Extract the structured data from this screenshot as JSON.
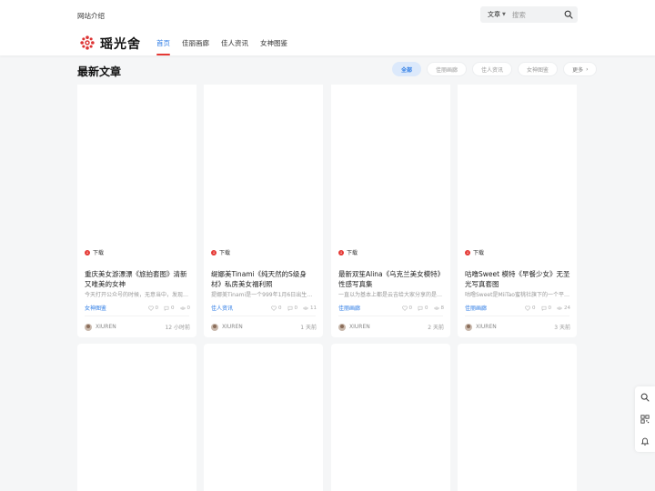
{
  "header": {
    "top_link": "网站介绍",
    "search_type": "文章",
    "search_placeholder": "搜索",
    "brand": "瑶光舍",
    "nav": [
      {
        "label": "首页",
        "active": true
      },
      {
        "label": "佳丽画廊",
        "active": false
      },
      {
        "label": "佳人资讯",
        "active": false
      },
      {
        "label": "女神图鉴",
        "active": false
      }
    ]
  },
  "section": {
    "title": "最新文章",
    "filters": [
      {
        "label": "全部",
        "active": true
      },
      {
        "label": "佳丽画廊",
        "active": false
      },
      {
        "label": "佳人资讯",
        "active": false
      },
      {
        "label": "女神图鉴",
        "active": false
      }
    ],
    "more_label": "更多"
  },
  "cards": [
    {
      "tag": "下载",
      "title": "重庆美女游漂漂《旅拍套图》清新又唯美的女神",
      "excerpt": "今天打开公众号的时候，无意当中，发现…",
      "category": "女神图鉴",
      "likes": "0",
      "comments": "0",
      "views": "0",
      "author": "XIUREN",
      "time": "12 小时前"
    },
    {
      "tag": "下载",
      "title": "缇娜美Tinami《纯天然的S级身材》私房美女福利照",
      "excerpt": "提娜美Tinami是一个999年1月6日出生的…",
      "category": "佳人资讯",
      "likes": "0",
      "comments": "0",
      "views": "11",
      "author": "XIUREN",
      "time": "1 天前"
    },
    {
      "tag": "下载",
      "title": "最新双笙Alina《乌克兰美女模特》性感写真集",
      "excerpt": "一直以为基本上都是云吉给大家分享的是…",
      "category": "佳丽画廊",
      "likes": "0",
      "comments": "0",
      "views": "8",
      "author": "XIUREN",
      "time": "2 天前"
    },
    {
      "tag": "下载",
      "title": "咕噜Sweet 模特《早餐少女》无圣光写真套图",
      "excerpt": "咕噜Sweet是MiiTao蜜桃社旗下的一个平…",
      "category": "佳丽画廊",
      "likes": "0",
      "comments": "0",
      "views": "24",
      "author": "XIUREN",
      "time": "3 天前"
    }
  ],
  "colors": {
    "accent": "#2c7be5",
    "active_underline": "#e53935",
    "tag_dot": "#e53935",
    "page_bg": "#f5f6f7"
  },
  "icons": {
    "search": "search-icon",
    "float_bar": [
      "search-icon",
      "qrcode-icon",
      "bell-icon"
    ]
  }
}
